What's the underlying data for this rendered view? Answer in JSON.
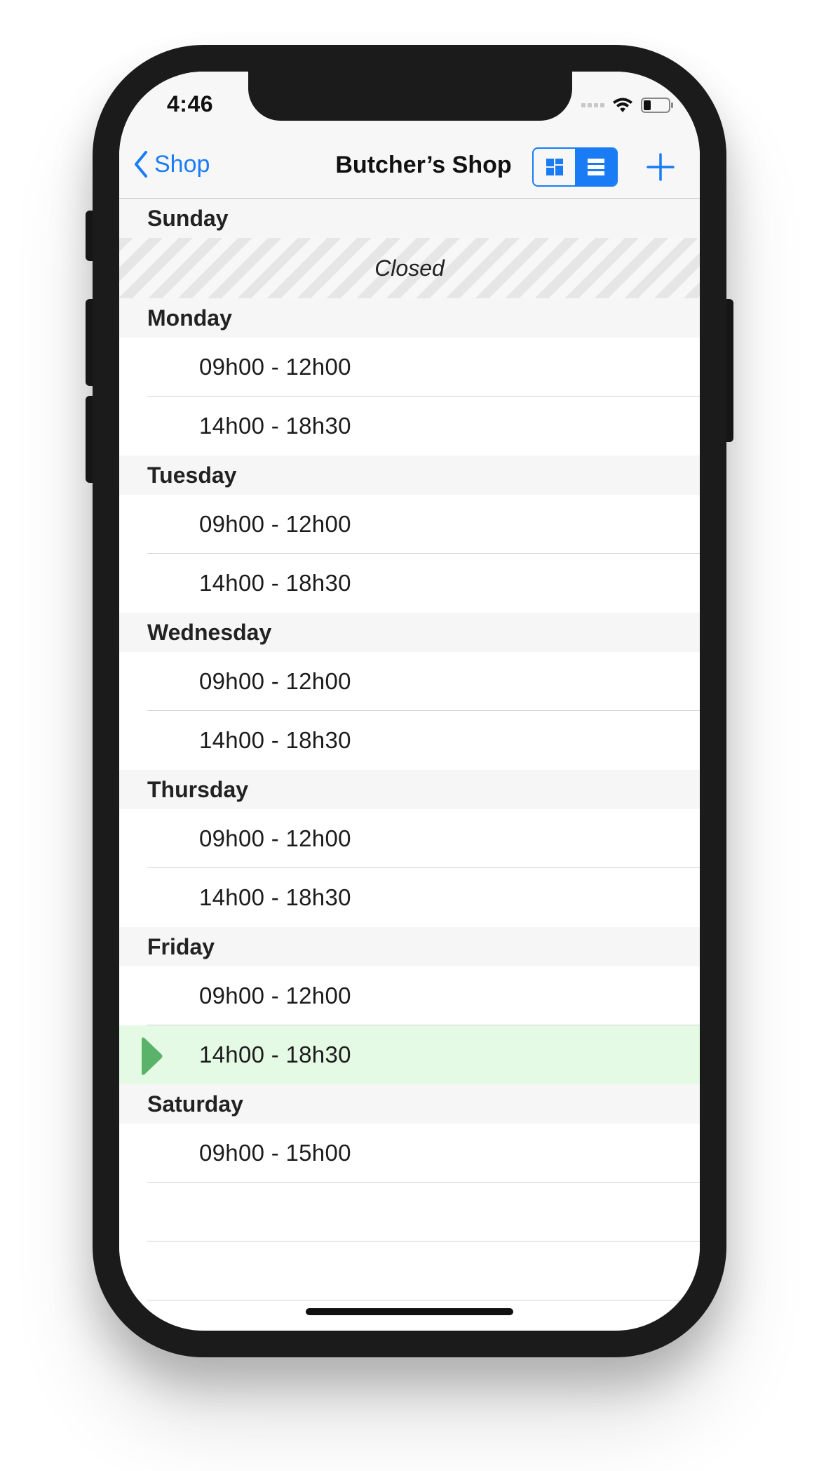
{
  "status_bar": {
    "time": "4:46"
  },
  "nav": {
    "back_label": "Shop",
    "title": "Butcher’s Shop",
    "view_modes": [
      "grid-view-icon",
      "list-view-icon"
    ],
    "active_view": "list",
    "accent_color": "#1a7cf5"
  },
  "days": [
    {
      "day": "Sunday",
      "closed_label": "Closed"
    },
    {
      "day": "Monday",
      "slots": [
        "09h00 - 12h00",
        "14h00 - 18h30"
      ]
    },
    {
      "day": "Tuesday",
      "slots": [
        "09h00 - 12h00",
        "14h00 - 18h30"
      ]
    },
    {
      "day": "Wednesday",
      "slots": [
        "09h00 - 12h00",
        "14h00 - 18h30"
      ]
    },
    {
      "day": "Thursday",
      "slots": [
        "09h00 - 12h00",
        "14h00 - 18h30"
      ]
    },
    {
      "day": "Friday",
      "slots": [
        "09h00 - 12h00",
        "14h00 - 18h30"
      ],
      "current_slot": "14h00 - 18h30"
    },
    {
      "day": "Saturday",
      "slots": [
        "09h00 - 15h00"
      ]
    }
  ],
  "colors": {
    "current_slot_background": "#e4fae4",
    "current_marker": "#5bb26b"
  }
}
